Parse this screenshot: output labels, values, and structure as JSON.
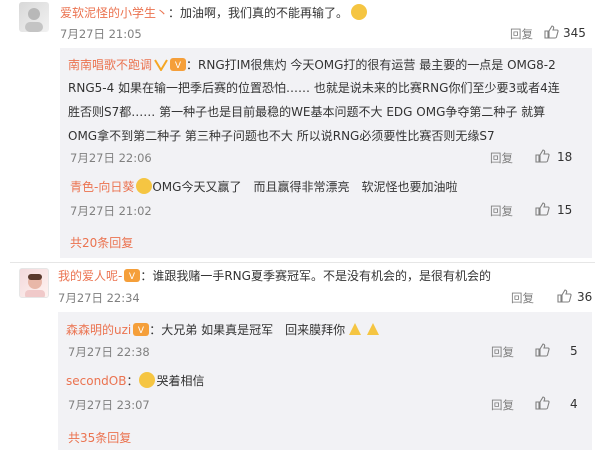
{
  "comments": [
    {
      "user": "爱软泥怪的小学生丶",
      "text": "：加油啊，我们真的不能再输了。",
      "time": "7月27日 21:05",
      "reply_label": "回复",
      "likes": "345"
    },
    {
      "user": "我的爱人呢-",
      "text": "：谁跟我赌一手RNG夏季赛冠军。不是没有机会的，是很有机会的",
      "time": "7月27日 22:34",
      "reply_label": "回复",
      "likes": "36"
    }
  ],
  "replies1": [
    {
      "user": "南南唱歌不跑调",
      "text_lines": [
        "：RNG打IM很焦灼 今天OMG打的很有运营 最主要的一点是 OMG8-2",
        "RNG5-4 如果在输一把季后赛的位置恐怕…… 也就是说未来的比赛RNG你们至少要3或者4连",
        "胜否则S7都…… 第一种子也是目前最稳的WE基本问题不大 EDG OMG争夺第二种子 就算",
        "OMG拿不到第二种子 第三种子问题也不大 所以说RNG必须要性比赛否则无缘S7"
      ],
      "time": "7月27日 22:06",
      "reply_label": "回复",
      "likes": "18"
    },
    {
      "user": "青色-向日葵",
      "text": "OMG今天又赢了　而且赢得非常漂亮　软泥怪也要加油啦",
      "time": "7月27日 21:02",
      "reply_label": "回复",
      "likes": "15"
    }
  ],
  "more1": "共20条回复",
  "replies2": [
    {
      "user": "森森明的uzi",
      "text": "：大兄弟 如果真是冠军　回来膜拜你",
      "time": "7月27日 22:38",
      "reply_label": "回复",
      "likes": "5"
    },
    {
      "user": "secondOB",
      "text": "哭着相信",
      "time": "7月27日 23:07",
      "reply_label": "回复",
      "likes": "4"
    }
  ],
  "more2": "共35条回复",
  "colors": {
    "link": "#eb7350",
    "meta": "#808080",
    "reply_bg": "#f2f2f5"
  }
}
